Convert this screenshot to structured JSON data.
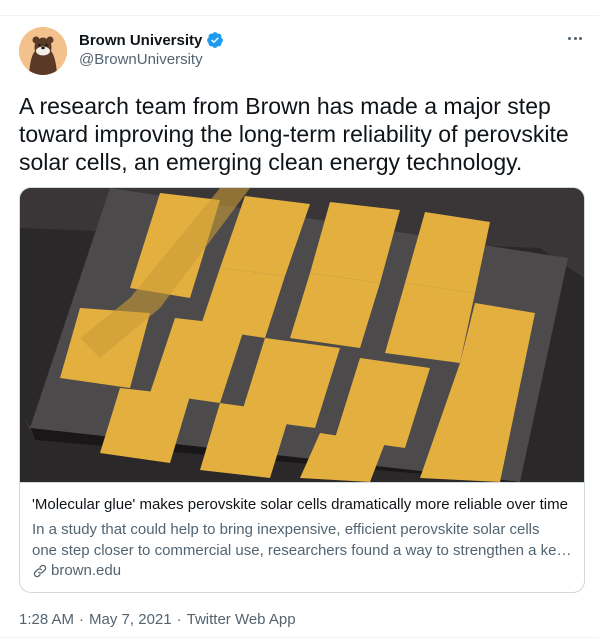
{
  "tweet": {
    "author_name": "Brown University",
    "author_handle": "@BrownUniversity",
    "verified": true,
    "text": "A research team from Brown has made a major step toward improving the long-term reliability of perovskite solar cells, an emerging clean energy technology.",
    "time": "1:28 AM",
    "date": "May 7, 2021",
    "source": "Twitter Web App",
    "separator": "·"
  },
  "card": {
    "title": "'Molecular glue' makes perovskite solar cells dramatically more reliable over time",
    "description_line1": "In a study that could help to bring inexpensive, efficient perovskite solar cells",
    "description_line2": "one step closer to commercial use, researchers found a way to strengthen a key interface",
    "domain": "brown.edu"
  },
  "colors": {
    "verified_blue": "#1d9bf0",
    "secondary_text": "#536471",
    "border": "#cfd9de",
    "avatar_bg": "#f3c28c",
    "gold": "#e3b040"
  }
}
